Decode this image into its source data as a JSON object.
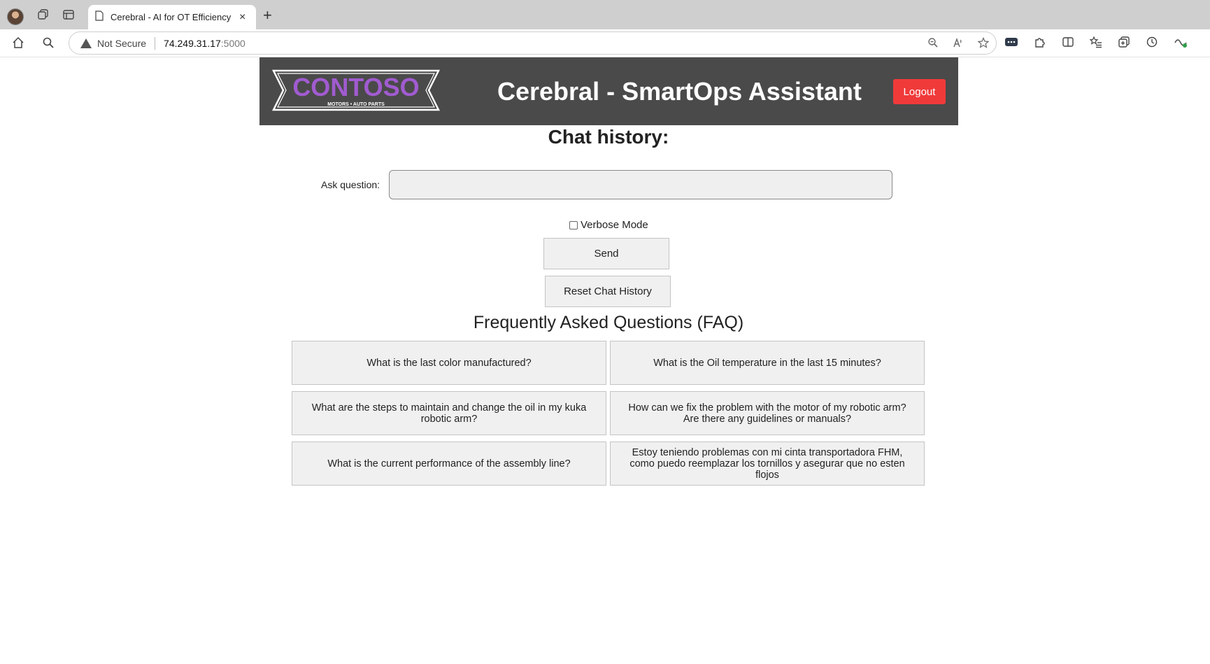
{
  "browser": {
    "tab_title": "Cerebral - AI for OT Efficiency",
    "tab_close": "×",
    "new_tab": "+",
    "not_secure": "Not Secure",
    "url_host": "74.249.31.17",
    "url_port": ":5000"
  },
  "header": {
    "logo_name": "CONTOSO",
    "logo_tagline": "MOTORS • AUTO PARTS",
    "title": "Cerebral - SmartOps Assistant",
    "logout_label": "Logout",
    "bg_color": "#4a4a4a",
    "logout_color": "#f03a3a",
    "logo_color": "#9b4fc9"
  },
  "chat": {
    "history_label": "Chat history:",
    "ask_label": "Ask question:",
    "input_value": "",
    "verbose_label": "Verbose Mode",
    "verbose_checked": false,
    "send_label": "Send",
    "reset_label": "Reset Chat History"
  },
  "faq": {
    "title": "Frequently Asked Questions (FAQ)",
    "items": [
      "What is the last color manufactured?",
      "What is the Oil temperature in the last 15 minutes?",
      "What are the steps to maintain and change the oil in my kuka robotic arm?",
      "How can we fix the problem with the motor of my robotic arm? Are there any guidelines or manuals?",
      "What is the current performance of the assembly line?",
      "Estoy teniendo problemas con mi cinta transportadora FHM, como puedo reemplazar los tornillos y asegurar que no esten flojos"
    ]
  }
}
